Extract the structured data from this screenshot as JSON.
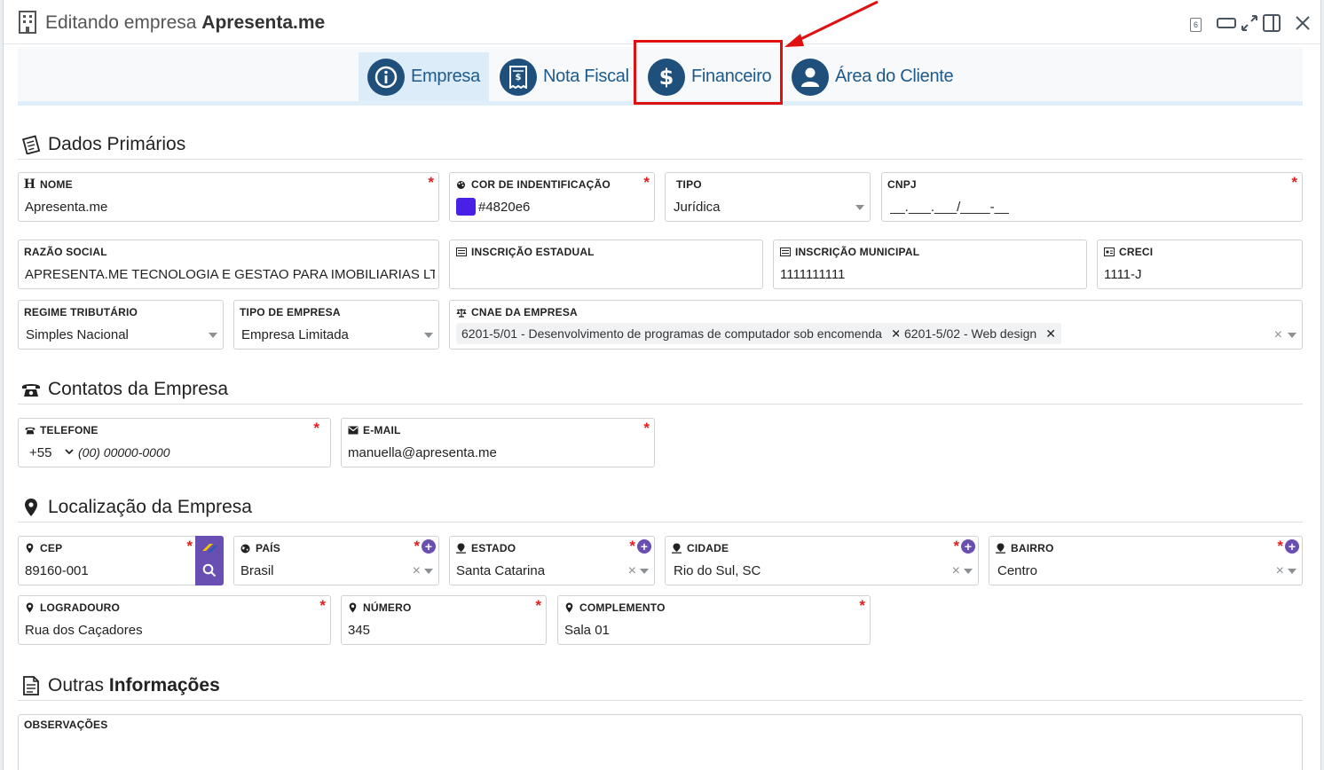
{
  "header": {
    "title_prefix": "Editando empresa",
    "title_name": "Apresenta.me",
    "badge": "6"
  },
  "tabs": [
    {
      "label": "Empresa",
      "icon": "info-icon",
      "active": true
    },
    {
      "label": "Nota Fiscal",
      "icon": "receipt-icon",
      "active": false
    },
    {
      "label": "Financeiro",
      "icon": "dollar-icon",
      "active": false
    },
    {
      "label": "Área do Cliente",
      "icon": "user-icon",
      "active": false
    }
  ],
  "sections": {
    "primary": "Dados Primários",
    "contacts": "Contatos da Empresa",
    "location": "Localização da Empresa",
    "other_prefix": "Outras",
    "other_bold": "Informações"
  },
  "fields": {
    "nome": {
      "label": "NOME",
      "value": "Apresenta.me"
    },
    "cor": {
      "label": "COR DE INDENTIFICAÇÃO",
      "value": "#4820e6",
      "color": "#4820e6"
    },
    "tipo": {
      "label": "TIPO",
      "value": "Jurídica"
    },
    "cnpj": {
      "label": "CNPJ",
      "placeholder": "__.___.___/____-__"
    },
    "razao": {
      "label": "RAZÃO SOCIAL",
      "value": "APRESENTA.ME TECNOLOGIA E GESTAO PARA IMOBILIARIAS LTDA"
    },
    "insc_estadual": {
      "label": "INSCRIÇÃO ESTADUAL",
      "value": ""
    },
    "insc_municipal": {
      "label": "INSCRIÇÃO MUNICIPAL",
      "value": "1111111111"
    },
    "creci": {
      "label": "CRECI",
      "value": "1111-J"
    },
    "regime": {
      "label": "REGIME TRIBUTÁRIO",
      "value": "Simples Nacional"
    },
    "tipo_empresa": {
      "label": "TIPO DE EMPRESA",
      "value": "Empresa Limitada"
    },
    "cnae": {
      "label": "CNAE DA EMPRESA",
      "chips": [
        "6201-5/01 - Desenvolvimento de programas de computador sob encomenda",
        "6201-5/02 - Web design"
      ]
    },
    "telefone": {
      "label": "TELEFONE",
      "country": "+55",
      "placeholder": "(00) 00000-0000"
    },
    "email": {
      "label": "E-MAIL",
      "value": "manuella@apresenta.me"
    },
    "cep": {
      "label": "CEP",
      "value": "89160-001"
    },
    "pais": {
      "label": "PAÍS",
      "value": "Brasil"
    },
    "estado": {
      "label": "ESTADO",
      "value": "Santa Catarina"
    },
    "cidade": {
      "label": "CIDADE",
      "value": "Rio do Sul, SC"
    },
    "bairro": {
      "label": "BAIRRO",
      "value": "Centro"
    },
    "logradouro": {
      "label": "LOGRADOURO",
      "value": "Rua dos Caçadores"
    },
    "numero": {
      "label": "NÚMERO",
      "value": "345"
    },
    "complemento": {
      "label": "COMPLEMENTO",
      "value": "Sala 01"
    },
    "observacoes": {
      "label": "OBSERVAÇÕES",
      "value": ""
    }
  },
  "common": {
    "required_mark": "*",
    "clear_mark": "×",
    "add_mark": "+",
    "chip_remove": "✕"
  },
  "colors": {
    "accent": "#1f4f7b",
    "tab_text": "#1e5a8a",
    "highlight": "#e01010",
    "purple": "#6a4fb3",
    "required": "#e02020"
  }
}
